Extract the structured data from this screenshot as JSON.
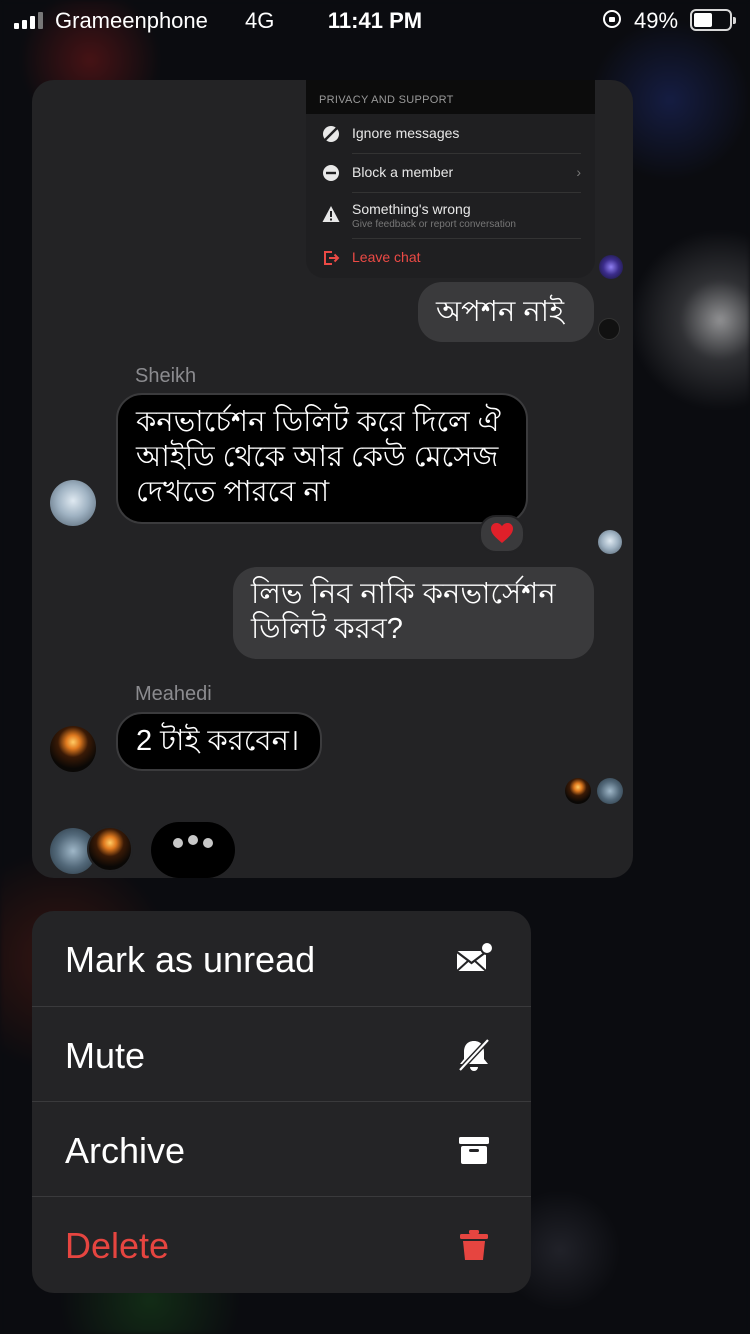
{
  "status_bar": {
    "carrier": "Grameenphone",
    "network": "4G",
    "time": "11:41 PM",
    "battery_percent": "49%",
    "battery_level": 0.49
  },
  "screenshot_menu": {
    "header": "PRIVACY AND SUPPORT",
    "items": [
      {
        "label": "Ignore messages",
        "icon": "ignore-icon"
      },
      {
        "label": "Block a member",
        "icon": "block-icon"
      },
      {
        "label": "Something's wrong",
        "sub": "Give feedback or report conversation",
        "icon": "warning-icon"
      },
      {
        "label": "Leave chat",
        "icon": "leave-icon"
      }
    ]
  },
  "chat": {
    "messages": [
      {
        "direction": "out",
        "text": "অপশন নাই"
      },
      {
        "direction": "in",
        "sender": "Sheikh",
        "text": "কনভার্চেশন ডিলিট করে দিলে ঐ আইডি থেকে আর কেউ মেসেজ দেখতে পারবে না",
        "reaction": "heart"
      },
      {
        "direction": "out",
        "text": "লিভ নিব নাকি কনভার্সেশন ডিলিট করব?"
      },
      {
        "direction": "in",
        "sender": "Meahedi",
        "text": "2 টাই করবেন।"
      }
    ]
  },
  "menu": {
    "items": [
      {
        "label": "Mark as unread",
        "icon": "mark-unread-icon"
      },
      {
        "label": "Mute",
        "icon": "bell-slash-icon"
      },
      {
        "label": "Archive",
        "icon": "archive-icon"
      },
      {
        "label": "Delete",
        "icon": "trash-icon",
        "color": "#e64540"
      }
    ]
  }
}
